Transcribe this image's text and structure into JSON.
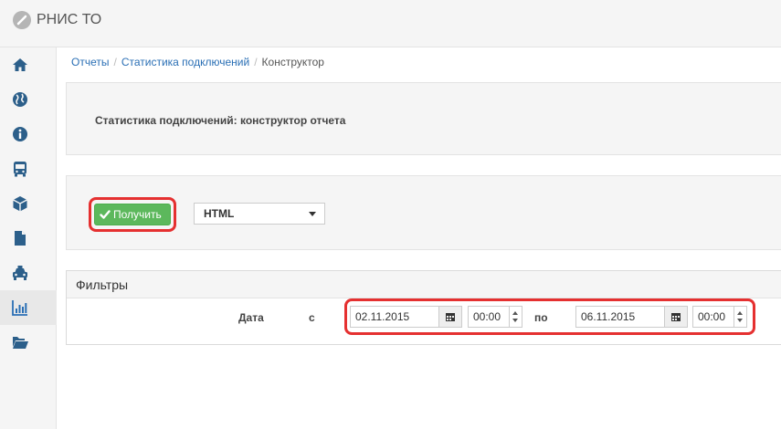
{
  "app": {
    "title": "РНИС ТО",
    "logo_icon": "slash-circle-icon"
  },
  "sidebar": {
    "items": [
      {
        "icon": "home-icon"
      },
      {
        "icon": "globe-icon"
      },
      {
        "icon": "info-icon"
      },
      {
        "icon": "bus-icon"
      },
      {
        "icon": "cube-icon"
      },
      {
        "icon": "document-icon"
      },
      {
        "icon": "taxi-icon"
      },
      {
        "icon": "bar-chart-icon",
        "active": true
      },
      {
        "icon": "folder-open-icon"
      }
    ]
  },
  "breadcrumb": {
    "items": [
      "Отчеты",
      "Статистика подключений"
    ],
    "separator": "/",
    "current": "Конструктор"
  },
  "header_panel": {
    "title": "Статистика подключений: конструктор отчета"
  },
  "toolbar": {
    "get_button_label": "Получить",
    "format_select_value": "HTML",
    "highlight_color": "#e53030",
    "button_color": "#5cb85c"
  },
  "filters": {
    "title": "Фильтры",
    "date_label": "Дата",
    "from_label": "с",
    "to_label": "по",
    "from_date": "02.11.2015",
    "from_time": "00:00",
    "to_date": "06.11.2015",
    "to_time": "00:00"
  }
}
